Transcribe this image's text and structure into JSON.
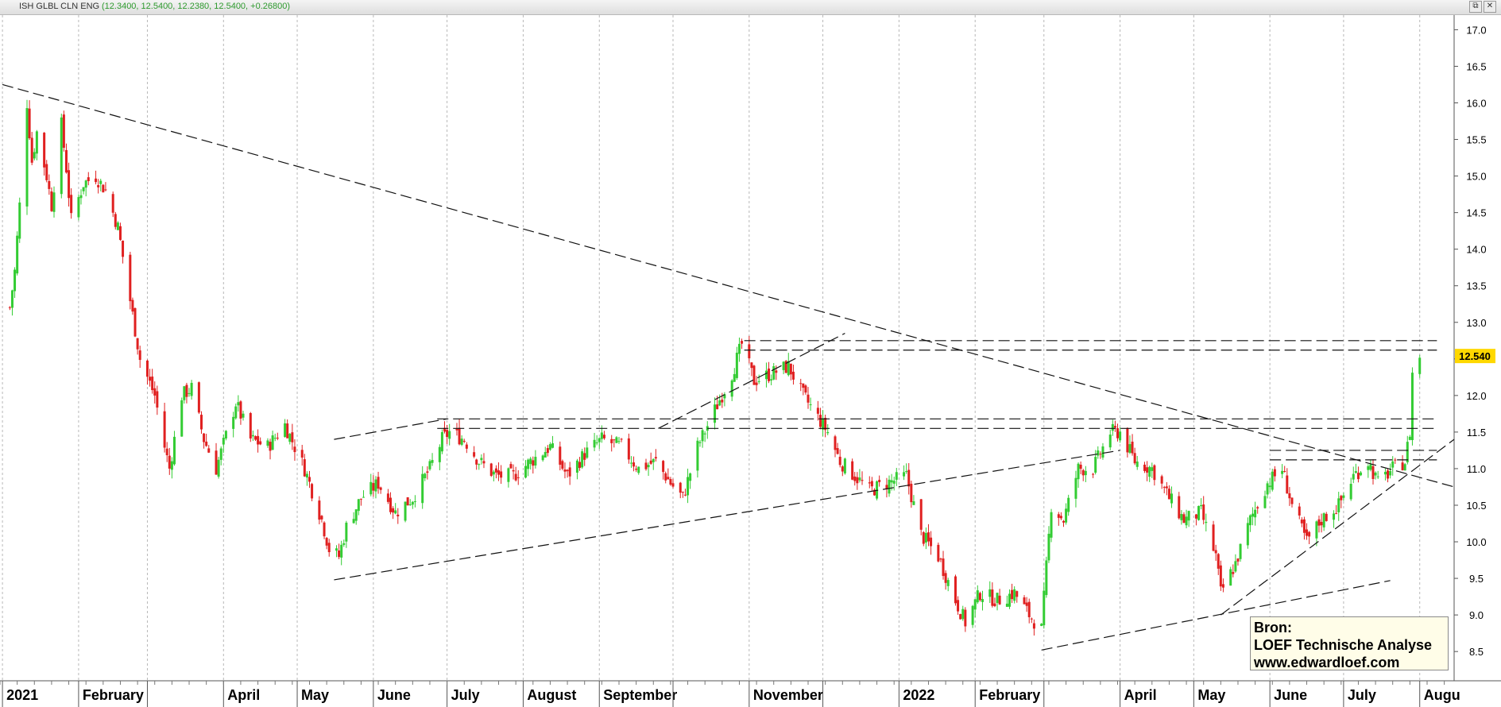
{
  "header": {
    "symbol": "ISH GLBL CLN ENG",
    "quote": "(12.3400, 12.5400, 12.2380, 12.5400, +0.26800)"
  },
  "window_buttons": [
    "⧉",
    "✕"
  ],
  "source_box": {
    "line1": "Bron:",
    "line2": "LOEF Technische Analyse",
    "line3": "www.edwardloef.com"
  },
  "chart_data": {
    "type": "candlestick",
    "ylim": [
      8.1,
      17.2
    ],
    "x_range": [
      "2020-12-31",
      "2022-08-15"
    ],
    "y_ticks": [
      "8.5",
      "9.0",
      "9.5",
      "10.0",
      "10.5",
      "11.0",
      "11.5",
      "12.0",
      "12.5",
      "13.0",
      "13.5",
      "14.0",
      "14.5",
      "15.0",
      "15.5",
      "16.0",
      "16.5",
      "17.0"
    ],
    "last_price": "12.540",
    "colors": {
      "up": "#33cc33",
      "down": "#e02020",
      "last_label_bg": "#ffd800",
      "grid": "#b8b8b8"
    },
    "x_labels": [
      {
        "date": "2021-01-01",
        "label": "2021"
      },
      {
        "date": "2021-02-01",
        "label": "February"
      },
      {
        "date": "2021-03-01",
        "label": ""
      },
      {
        "date": "2021-04-01",
        "label": "April"
      },
      {
        "date": "2021-05-01",
        "label": "May"
      },
      {
        "date": "2021-06-01",
        "label": "June"
      },
      {
        "date": "2021-07-01",
        "label": "July"
      },
      {
        "date": "2021-08-01",
        "label": "August"
      },
      {
        "date": "2021-09-01",
        "label": "September"
      },
      {
        "date": "2021-10-01",
        "label": ""
      },
      {
        "date": "2021-11-01",
        "label": "November"
      },
      {
        "date": "2021-12-01",
        "label": ""
      },
      {
        "date": "2022-01-01",
        "label": "2022"
      },
      {
        "date": "2022-02-01",
        "label": "February"
      },
      {
        "date": "2022-03-01",
        "label": ""
      },
      {
        "date": "2022-04-01",
        "label": "April"
      },
      {
        "date": "2022-05-01",
        "label": "May"
      },
      {
        "date": "2022-06-01",
        "label": "June"
      },
      {
        "date": "2022-07-01",
        "label": "July"
      },
      {
        "date": "2022-08-01",
        "label": "Augu"
      }
    ],
    "close_path": [
      [
        "2021-01-04",
        13.2
      ],
      [
        "2021-01-06",
        13.7
      ],
      [
        "2021-01-08",
        14.6
      ],
      [
        "2021-01-11",
        16.0
      ],
      [
        "2021-01-13",
        15.2
      ],
      [
        "2021-01-15",
        15.6
      ],
      [
        "2021-01-19",
        15.0
      ],
      [
        "2021-01-21",
        14.6
      ],
      [
        "2021-01-25",
        15.7
      ],
      [
        "2021-01-27",
        15.1
      ],
      [
        "2021-01-29",
        14.4
      ],
      [
        "2021-02-03",
        14.9
      ],
      [
        "2021-02-08",
        15.0
      ],
      [
        "2021-02-12",
        14.8
      ],
      [
        "2021-02-17",
        14.3
      ],
      [
        "2021-02-22",
        13.3
      ],
      [
        "2021-02-26",
        12.5
      ],
      [
        "2021-03-04",
        12.0
      ],
      [
        "2021-03-08",
        11.3
      ],
      [
        "2021-03-10",
        11.0
      ],
      [
        "2021-03-15",
        12.0
      ],
      [
        "2021-03-19",
        12.1
      ],
      [
        "2021-03-24",
        11.4
      ],
      [
        "2021-03-29",
        11.0
      ],
      [
        "2021-04-06",
        11.9
      ],
      [
        "2021-04-12",
        11.4
      ],
      [
        "2021-04-19",
        11.3
      ],
      [
        "2021-04-26",
        11.6
      ],
      [
        "2021-05-04",
        11.0
      ],
      [
        "2021-05-11",
        10.3
      ],
      [
        "2021-05-14",
        9.9
      ],
      [
        "2021-05-18",
        9.8
      ],
      [
        "2021-05-21",
        10.2
      ],
      [
        "2021-05-27",
        10.6
      ],
      [
        "2021-06-03",
        10.8
      ],
      [
        "2021-06-10",
        10.4
      ],
      [
        "2021-06-17",
        10.6
      ],
      [
        "2021-06-24",
        11.0
      ],
      [
        "2021-06-29",
        11.4
      ],
      [
        "2021-07-02",
        11.5
      ],
      [
        "2021-07-08",
        11.4
      ],
      [
        "2021-07-14",
        11.1
      ],
      [
        "2021-07-21",
        10.9
      ],
      [
        "2021-07-28",
        10.9
      ],
      [
        "2021-08-04",
        11.1
      ],
      [
        "2021-08-12",
        11.3
      ],
      [
        "2021-08-19",
        10.9
      ],
      [
        "2021-08-26",
        11.2
      ],
      [
        "2021-09-02",
        11.4
      ],
      [
        "2021-09-10",
        11.3
      ],
      [
        "2021-09-17",
        11.0
      ],
      [
        "2021-09-24",
        11.1
      ],
      [
        "2021-09-30",
        10.8
      ],
      [
        "2021-10-05",
        10.6
      ],
      [
        "2021-10-11",
        11.3
      ],
      [
        "2021-10-18",
        11.8
      ],
      [
        "2021-10-25",
        12.3
      ],
      [
        "2021-10-29",
        12.7
      ],
      [
        "2021-11-03",
        12.2
      ],
      [
        "2021-11-10",
        12.3
      ],
      [
        "2021-11-17",
        12.4
      ],
      [
        "2021-11-23",
        12.0
      ],
      [
        "2021-11-29",
        11.7
      ],
      [
        "2021-12-03",
        11.5
      ],
      [
        "2021-12-08",
        11.1
      ],
      [
        "2021-12-14",
        10.9
      ],
      [
        "2021-12-20",
        10.7
      ],
      [
        "2021-12-27",
        10.8
      ],
      [
        "2022-01-04",
        10.9
      ],
      [
        "2022-01-10",
        10.1
      ],
      [
        "2022-01-17",
        9.8
      ],
      [
        "2022-01-24",
        9.2
      ],
      [
        "2022-01-28",
        8.9
      ],
      [
        "2022-02-03",
        9.3
      ],
      [
        "2022-02-10",
        9.2
      ],
      [
        "2022-02-17",
        9.3
      ],
      [
        "2022-02-23",
        9.0
      ],
      [
        "2022-02-28",
        8.8
      ],
      [
        "2022-03-04",
        10.5
      ],
      [
        "2022-03-09",
        10.3
      ],
      [
        "2022-03-15",
        11.0
      ],
      [
        "2022-03-21",
        11.0
      ],
      [
        "2022-03-28",
        11.5
      ],
      [
        "2022-04-01",
        11.5
      ],
      [
        "2022-04-07",
        11.1
      ],
      [
        "2022-04-14",
        11.0
      ],
      [
        "2022-04-21",
        10.6
      ],
      [
        "2022-04-27",
        10.3
      ],
      [
        "2022-05-04",
        10.4
      ],
      [
        "2022-05-10",
        9.8
      ],
      [
        "2022-05-12",
        9.3
      ],
      [
        "2022-05-18",
        9.7
      ],
      [
        "2022-05-24",
        10.3
      ],
      [
        "2022-05-31",
        10.8
      ],
      [
        "2022-06-06",
        11.0
      ],
      [
        "2022-06-10",
        10.5
      ],
      [
        "2022-06-16",
        10.0
      ],
      [
        "2022-06-22",
        10.3
      ],
      [
        "2022-06-29",
        10.5
      ],
      [
        "2022-07-05",
        10.9
      ],
      [
        "2022-07-11",
        11.1
      ],
      [
        "2022-07-15",
        10.8
      ],
      [
        "2022-07-21",
        11.0
      ],
      [
        "2022-07-26",
        11.1
      ],
      [
        "2022-07-28",
        11.5
      ],
      [
        "2022-07-29",
        12.3
      ],
      [
        "2022-08-01",
        12.54
      ]
    ],
    "trendlines": [
      {
        "from": [
          "2021-01-01",
          16.25
        ],
        "to": [
          "2022-08-15",
          10.75
        ]
      },
      {
        "from": [
          "2021-05-16",
          11.4
        ],
        "to": [
          "2021-07-01",
          11.68
        ]
      },
      {
        "from": [
          "2021-05-16",
          9.48
        ],
        "to": [
          "2022-04-01",
          11.25
        ]
      },
      {
        "from": [
          "2021-09-25",
          11.55
        ],
        "to": [
          "2021-12-10",
          12.85
        ]
      },
      {
        "from": [
          "2022-02-28",
          8.52
        ],
        "to": [
          "2022-07-20",
          9.47
        ]
      },
      {
        "from": [
          "2022-05-12",
          9.0
        ],
        "to": [
          "2022-08-15",
          11.4
        ]
      },
      {
        "from": [
          "2021-10-30",
          12.75
        ],
        "to": [
          "2022-08-08",
          12.75
        ]
      },
      {
        "from": [
          "2021-10-30",
          12.62
        ],
        "to": [
          "2022-08-08",
          12.62
        ]
      },
      {
        "from": [
          "2021-06-27",
          11.68
        ],
        "to": [
          "2022-08-08",
          11.68
        ]
      },
      {
        "from": [
          "2021-06-27",
          11.55
        ],
        "to": [
          "2022-08-08",
          11.55
        ]
      },
      {
        "from": [
          "2022-06-01",
          11.25
        ],
        "to": [
          "2022-08-08",
          11.25
        ]
      },
      {
        "from": [
          "2022-06-01",
          11.12
        ],
        "to": [
          "2022-08-08",
          11.12
        ]
      }
    ]
  }
}
